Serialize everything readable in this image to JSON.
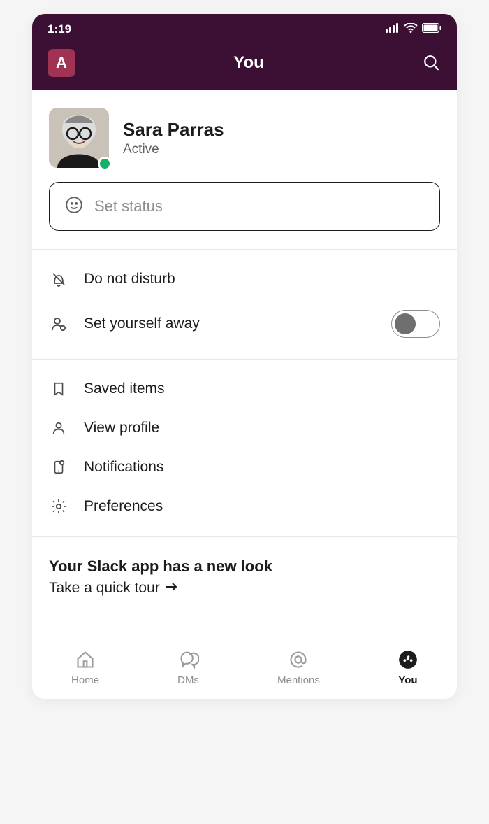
{
  "statusbar": {
    "time": "1:19"
  },
  "header": {
    "workspace_initial": "A",
    "title": "You"
  },
  "profile": {
    "name": "Sara Parras",
    "status": "Active"
  },
  "status_input": {
    "placeholder": "Set status"
  },
  "menu": {
    "dnd": "Do not disturb",
    "away": "Set yourself away",
    "saved": "Saved items",
    "view_profile": "View profile",
    "notifications": "Notifications",
    "preferences": "Preferences"
  },
  "promo": {
    "title": "Your Slack app has a new look",
    "link": "Take a quick tour"
  },
  "tabs": {
    "home": "Home",
    "dms": "DMs",
    "mentions": "Mentions",
    "you": "You"
  }
}
